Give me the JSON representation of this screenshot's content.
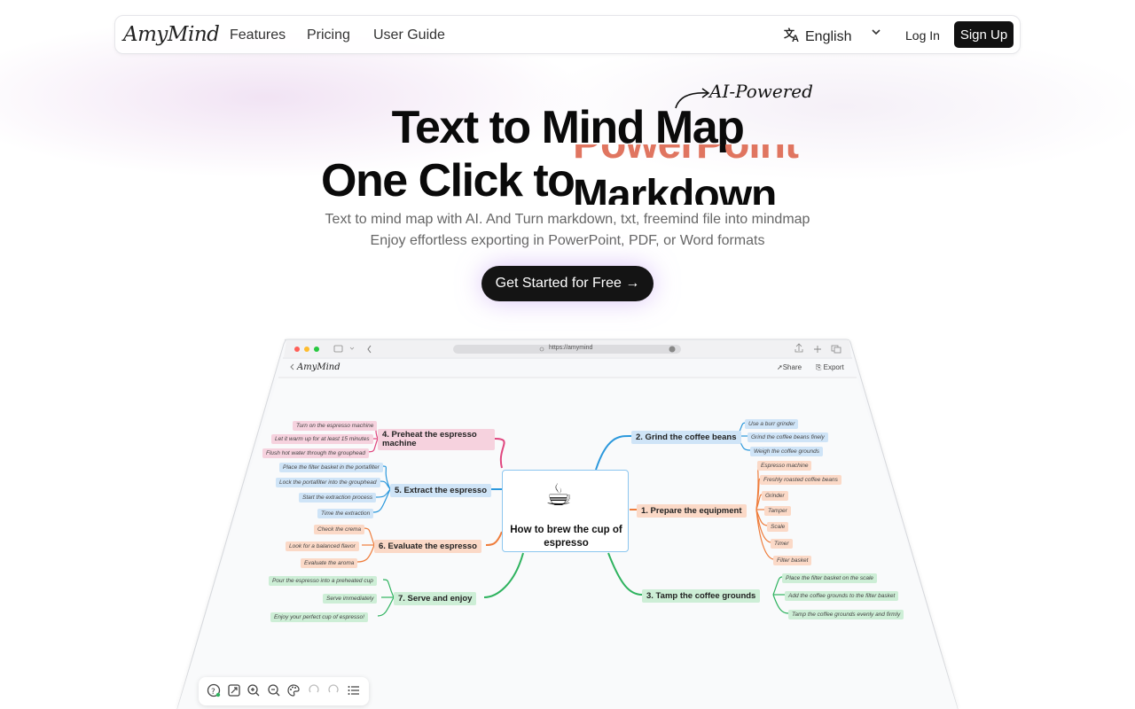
{
  "nav": {
    "logo": "AmyMind",
    "links": [
      "Features",
      "Pricing",
      "User Guide"
    ],
    "language": "English",
    "login": "Log In",
    "signup": "Sign Up"
  },
  "hero": {
    "badge": "AI-Powered",
    "title_line1": "Text to Mind Map",
    "title_line2_prefix": "One Click to",
    "rotating_words": [
      "PowerPoint",
      "Markdown"
    ],
    "subtitle_line1": "Text to mind map with AI. And Turn markdown, txt, freemind file into mindmap",
    "subtitle_line2": "Enjoy effortless exporting in PowerPoint, PDF, or Word formats",
    "cta": "Get Started for Free →"
  },
  "mockup": {
    "url": "https://amymind",
    "app_logo": "AmyMind",
    "share": "Share",
    "export": "Export",
    "center": "How to brew the cup of espresso",
    "branches": [
      {
        "title": "4. Preheat the espresso machine",
        "color": "pink",
        "leaves": [
          "Turn on the espresso machine",
          "Let it warm up for at least 15 minutes",
          "Flush hot water through the grouphead"
        ]
      },
      {
        "title": "5. Extract the espresso",
        "color": "blue",
        "leaves": [
          "Place the filter basket in the portafilter",
          "Lock the portafilter into the grouphead",
          "Start the extraction process",
          "Time the extraction"
        ]
      },
      {
        "title": "6. Evaluate the espresso",
        "color": "orange",
        "leaves": [
          "Check the crema",
          "Look for a balanced flavor",
          "Evaluate the aroma"
        ]
      },
      {
        "title": "7. Serve and enjoy",
        "color": "green",
        "leaves": [
          "Pour the espresso into a preheated cup",
          "Serve immediately",
          "Enjoy your perfect cup of espresso!"
        ]
      },
      {
        "title": "2. Grind the coffee beans",
        "color": "blue",
        "leaves": [
          "Use a burr grinder",
          "Grind the coffee beans finely",
          "Weigh the coffee grounds"
        ]
      },
      {
        "title": "1. Prepare the equipment",
        "color": "orange",
        "leaves": [
          "Espresso machine",
          "Freshly roasted coffee beans",
          "Grinder",
          "Tamper",
          "Scale",
          "Timer",
          "Filter basket"
        ]
      },
      {
        "title": "3. Tamp the coffee grounds",
        "color": "green",
        "leaves": [
          "Place the filter basket on the scale",
          "Add the coffee grounds to the filter basket",
          "Tamp the coffee grounds evenly and firmly"
        ]
      }
    ],
    "colors": {
      "pink": "#e0477f",
      "blue": "#2b98dc",
      "orange": "#ef7d3c",
      "green": "#2fb35f"
    }
  }
}
